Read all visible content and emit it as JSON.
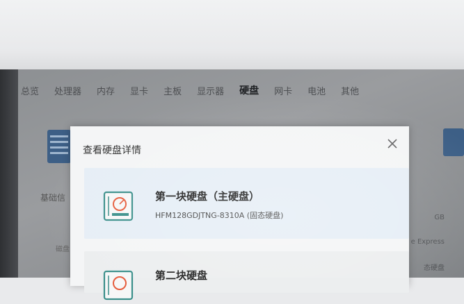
{
  "nav": {
    "items": [
      "总览",
      "处理器",
      "内存",
      "显卡",
      "主板",
      "显示器",
      "硬盘",
      "网卡",
      "电池",
      "其他"
    ],
    "active_index": 6
  },
  "background": {
    "tab_label": "基础信",
    "row_label": "磁盘",
    "right_values": [
      "GB",
      "e Express",
      "态硬盘"
    ]
  },
  "dialog": {
    "title": "查看硬盘详情",
    "disks": [
      {
        "title": "第一块硬盘（主硬盘）",
        "subtitle": "HFM128GDJTNG-8310A (固态硬盘)"
      },
      {
        "title": "第二块硬盘",
        "subtitle": ""
      }
    ]
  },
  "colors": {
    "dialog_bg": "#f4f5f6",
    "selected_card_bg": "#e6eef6",
    "icon_accent": "#e65c3c",
    "icon_teal": "#3a8f8a"
  }
}
